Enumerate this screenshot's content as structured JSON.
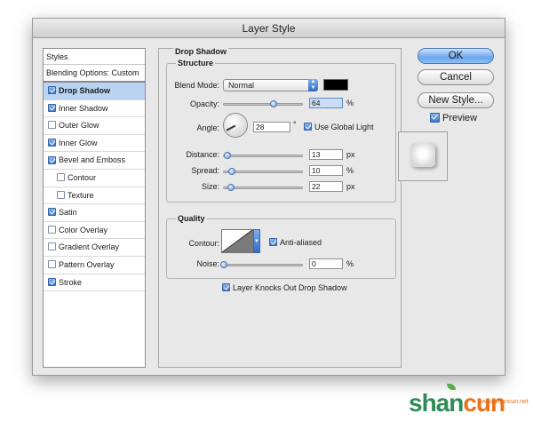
{
  "window": {
    "title": "Layer Style"
  },
  "styles_list": {
    "header": "Styles",
    "blending": "Blending Options: Custom",
    "items": [
      {
        "label": "Drop Shadow",
        "checked": true,
        "selected": true,
        "sub": false
      },
      {
        "label": "Inner Shadow",
        "checked": true,
        "selected": false,
        "sub": false
      },
      {
        "label": "Outer Glow",
        "checked": false,
        "selected": false,
        "sub": false
      },
      {
        "label": "Inner Glow",
        "checked": true,
        "selected": false,
        "sub": false
      },
      {
        "label": "Bevel and Emboss",
        "checked": true,
        "selected": false,
        "sub": false
      },
      {
        "label": "Contour",
        "checked": false,
        "selected": false,
        "sub": true
      },
      {
        "label": "Texture",
        "checked": false,
        "selected": false,
        "sub": true
      },
      {
        "label": "Satin",
        "checked": true,
        "selected": false,
        "sub": false
      },
      {
        "label": "Color Overlay",
        "checked": false,
        "selected": false,
        "sub": false
      },
      {
        "label": "Gradient Overlay",
        "checked": false,
        "selected": false,
        "sub": false
      },
      {
        "label": "Pattern Overlay",
        "checked": false,
        "selected": false,
        "sub": false
      },
      {
        "label": "Stroke",
        "checked": true,
        "selected": false,
        "sub": false
      }
    ]
  },
  "drop_shadow": {
    "title": "Drop Shadow",
    "structure": {
      "title": "Structure",
      "blend_mode_label": "Blend Mode:",
      "blend_mode_value": "Normal",
      "shadow_color": "#000000",
      "opacity_label": "Opacity:",
      "opacity_value": "64",
      "opacity_unit": "%",
      "opacity_level": 0.64,
      "angle_label": "Angle:",
      "angle_value": "28",
      "angle_unit": "°",
      "use_global_light_label": "Use Global Light",
      "use_global_light": true,
      "distance_label": "Distance:",
      "distance_value": "13",
      "distance_unit": "px",
      "distance_level": 0.05,
      "spread_label": "Spread:",
      "spread_value": "10",
      "spread_unit": "%",
      "spread_level": 0.1,
      "size_label": "Size:",
      "size_value": "22",
      "size_unit": "px",
      "size_level": 0.09
    },
    "quality": {
      "title": "Quality",
      "contour_label": "Contour:",
      "anti_aliased_label": "Anti-aliased",
      "anti_aliased": true,
      "noise_label": "Noise:",
      "noise_value": "0",
      "noise_unit": "%",
      "noise_level": 0
    },
    "knockout_label": "Layer Knocks Out Drop Shadow",
    "knockout": true
  },
  "buttons": {
    "ok": "OK",
    "cancel": "Cancel",
    "new_style": "New Style...",
    "preview_label": "Preview",
    "preview": true
  },
  "watermark": {
    "brand_green": "shan",
    "brand_orange": "cun",
    "sub": "www.shancun.net"
  },
  "colors": {
    "accent": "#3d79c7",
    "selection": "#b9d3f2"
  }
}
